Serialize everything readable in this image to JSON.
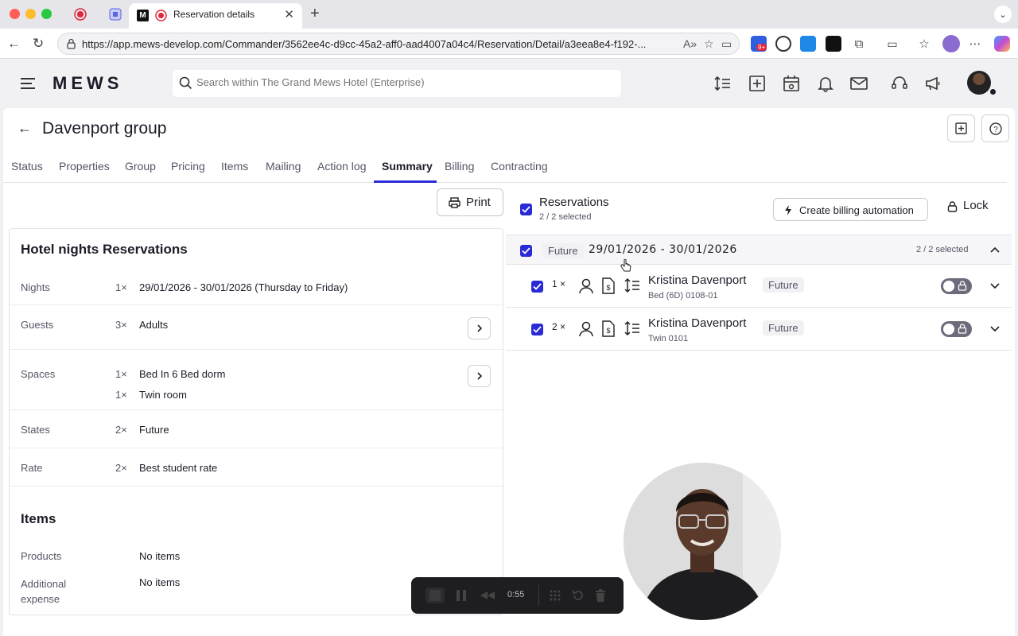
{
  "browser": {
    "tab_title": "Reservation details",
    "url": "https://app.mews-develop.com/Commander/3562ee4c-d9cc-45a2-aff0-aad4007a04c4/Reservation/Detail/a3eea8e4-f192-...",
    "ext_badge": "9+"
  },
  "app": {
    "logo": "MEWS",
    "search_placeholder": "Search within The Grand Mews Hotel (Enterprise)"
  },
  "page": {
    "title": "Davenport group",
    "tabs": [
      {
        "label": "Status"
      },
      {
        "label": "Properties"
      },
      {
        "label": "Group"
      },
      {
        "label": "Pricing"
      },
      {
        "label": "Items"
      },
      {
        "label": "Mailing"
      },
      {
        "label": "Action log"
      },
      {
        "label": "Summary"
      },
      {
        "label": "Billing"
      },
      {
        "label": "Contracting"
      }
    ],
    "active_tab": "Summary"
  },
  "summary": {
    "print_label": "Print",
    "section_title": "Hotel nights Reservations",
    "nights": {
      "label": "Nights",
      "qty": "1×",
      "value": "29/01/2026 - 30/01/2026 (Thursday to Friday)"
    },
    "guests": {
      "label": "Guests",
      "qty": "3×",
      "value": "Adults"
    },
    "spaces": {
      "label": "Spaces",
      "qty1": "1×",
      "value1": "Bed In 6 Bed dorm",
      "qty2": "1×",
      "value2": "Twin room"
    },
    "states": {
      "label": "States",
      "qty": "2×",
      "value": "Future"
    },
    "rate": {
      "label": "Rate",
      "qty": "2×",
      "value": "Best student rate"
    },
    "items_title": "Items",
    "products": {
      "label": "Products",
      "value": "No items"
    },
    "additional": {
      "label": "Additional expense",
      "value": "No items"
    }
  },
  "reservations": {
    "title": "Reservations",
    "selected": "2 / 2 selected",
    "billing_automation_label": "Create billing automation",
    "lock_label": "Lock",
    "group": {
      "state": "Future",
      "dates": "29/01/2026 - 30/01/2026",
      "selected": "2 / 2 selected"
    },
    "rows": [
      {
        "qty": "1 ×",
        "name": "Kristina Davenport",
        "room": "Bed (6D) 0108-01",
        "state": "Future"
      },
      {
        "qty": "2 ×",
        "name": "Kristina Davenport",
        "room": "Twin 0101",
        "state": "Future"
      }
    ]
  },
  "recorder": {
    "time": "0:55"
  },
  "colors": {
    "accent": "#2a2ad6",
    "text": "#1c1c28",
    "muted": "#555566"
  }
}
